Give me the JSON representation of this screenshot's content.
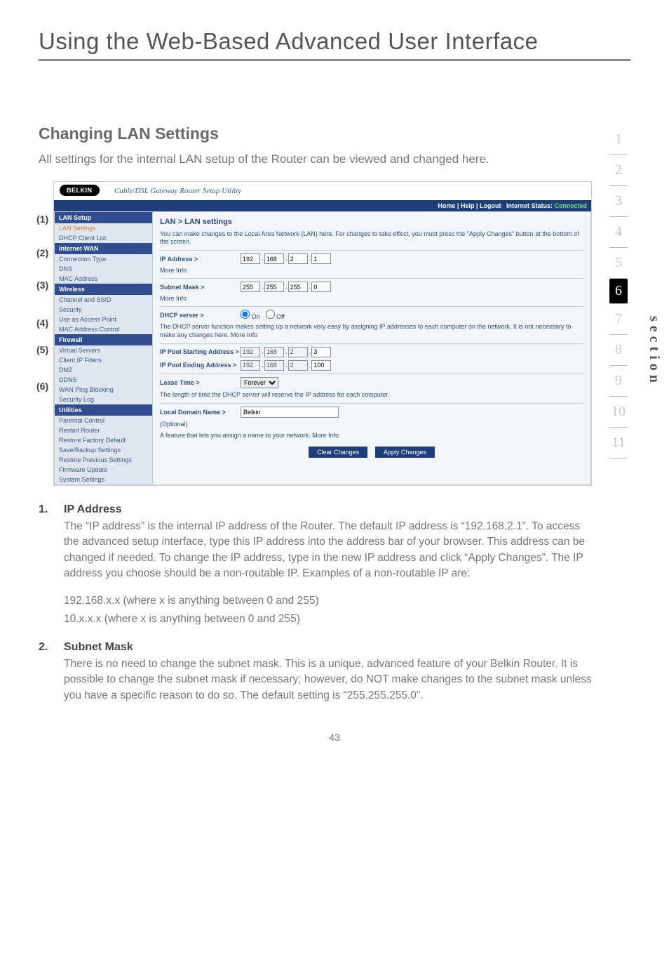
{
  "page_title": "Using the Web-Based Advanced User Interface",
  "section_title": "Changing LAN Settings",
  "section_intro": "All settings for the internal LAN setup of the Router can be viewed and changed here.",
  "callouts": [
    "(1)",
    "(2)",
    "(3)",
    "(4)",
    "(5)",
    "(6)"
  ],
  "side_numbers": [
    "1",
    "2",
    "3",
    "4",
    "5",
    "6",
    "7",
    "8",
    "9",
    "10",
    "11"
  ],
  "side_active": "6",
  "side_label": "section",
  "page_number": "43",
  "items": {
    "ip": {
      "num": "1.",
      "label": "IP Address",
      "desc": "The “IP address” is the internal IP address of the Router. The default IP address is “192.168.2.1”. To access the advanced setup interface, type this IP address into the address bar of your browser. This address can be changed if needed. To change the IP address, type in the new IP address and click “Apply Changes”. The IP address you choose should be a non-routable IP. Examples of a non-routable IP are:",
      "ex1": "192.168.x.x (where x is anything between 0 and 255)",
      "ex2": "10.x.x.x (where x is anything between 0 and 255)"
    },
    "subnet": {
      "num": "2.",
      "label": "Subnet Mask",
      "desc": "There is no need to change the subnet mask. This is a unique, advanced feature of your Belkin Router. It is possible to change the subnet mask if necessary; however, do NOT make changes to the subnet mask unless you have a specific reason to do so. The default setting is “255.255.255.0”."
    }
  },
  "shot": {
    "brand": "BELKIN",
    "utility_title": "Cable/DSL Gateway Router Setup Utility",
    "topnav": "Home | Help | Logout   Internet Status:",
    "status": "Connected",
    "sidenav": {
      "lan_setup": "LAN Setup",
      "lan_settings": "LAN Settings",
      "dhcp_client_list": "DHCP Client List",
      "internet_wan": "Internet WAN",
      "connection_type": "Connection Type",
      "dns": "DNS",
      "mac_address": "MAC Address",
      "wireless": "Wireless",
      "channel_ssid": "Channel and SSID",
      "security": "Security",
      "use_ap": "Use as Access Point",
      "mac_ctrl": "MAC Address Control",
      "firewall": "Firewall",
      "virtual_servers": "Virtual Servers",
      "client_filters": "Client IP Filters",
      "dmz": "DMZ",
      "ddns": "DDNS",
      "wan_ping": "WAN Ping Blocking",
      "sec_log": "Security Log",
      "utilities": "Utilities",
      "parental": "Parental Control",
      "restart": "Restart Router",
      "restore_factory": "Restore Factory Default",
      "save_backup": "Save/Backup Settings",
      "restore_prev": "Restore Previous Settings",
      "firmware": "Firmware Update",
      "system": "System Settings"
    },
    "main": {
      "crumb": "LAN > LAN settings",
      "intro": "You can make changes to the Local Area Network (LAN) here. For changes to take effect, you must press the \"Apply Changes\" button at the bottom of the screen.",
      "ip_label": "IP Address >",
      "ip": [
        "192",
        "168",
        "2",
        "1"
      ],
      "more_info": "More Info",
      "subnet_label": "Subnet Mask >",
      "subnet": [
        "255",
        "255",
        "255",
        "0"
      ],
      "dhcp_label": "DHCP server >",
      "on": "On",
      "off": "Off",
      "dhcp_desc": "The DHCP server function makes setting up a network very easy by assigning IP addresses to each computer on the network. It is not necessary to make any changes here. More Info",
      "pool_start_label": "IP Pool Starting Address >",
      "pool_start": [
        "192",
        "168",
        "2",
        "3"
      ],
      "pool_end_label": "IP Pool Ending Address >",
      "pool_end": [
        "192",
        "168",
        "2",
        "100"
      ],
      "lease_label": "Lease Time >",
      "lease_value": "Forever",
      "lease_desc": "The length of time the DHCP server will reserve the IP address for each computer.",
      "domain_label": "Local Domain Name >",
      "domain_value": "Belkin",
      "optional": "(Optional)",
      "domain_desc": "A feature that lets you assign a name to your network. More Info",
      "clear_btn": "Clear Changes",
      "apply_btn": "Apply Changes"
    }
  }
}
